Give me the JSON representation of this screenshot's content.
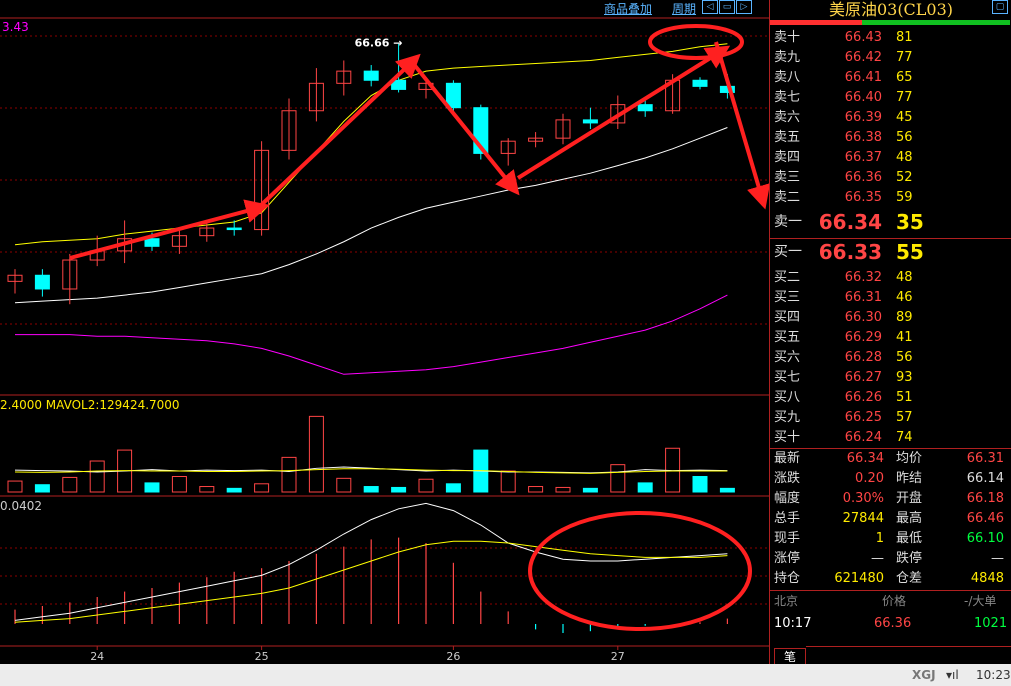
{
  "toolbar": {
    "overlay_label": "商品叠加",
    "period_label": "周期"
  },
  "indicator_labels": {
    "main_top": "3.43",
    "volume": "2.4000  MAVOL2:129424.7000",
    "macd": "0.0402"
  },
  "colors": {
    "up": "#ff4545",
    "down": "#00ffff",
    "ma1": "#ffff00",
    "ma2": "#ffffff",
    "ma3": "#ff00ff",
    "grid": "#8b0000",
    "arrow": "#ff2020"
  },
  "chart_data": [
    {
      "type": "candlestick",
      "name": "price",
      "x_ticks": [
        "24",
        "25",
        "26",
        "27"
      ],
      "peak_label": "66.66",
      "candles": [
        {
          "o": 65.1,
          "h": 65.18,
          "l": 65.02,
          "c": 65.14
        },
        {
          "o": 65.14,
          "h": 65.18,
          "l": 65.0,
          "c": 65.05
        },
        {
          "o": 65.05,
          "h": 65.28,
          "l": 64.95,
          "c": 65.24
        },
        {
          "o": 65.24,
          "h": 65.4,
          "l": 65.2,
          "c": 65.3
        },
        {
          "o": 65.3,
          "h": 65.5,
          "l": 65.22,
          "c": 65.38
        },
        {
          "o": 65.38,
          "h": 65.42,
          "l": 65.3,
          "c": 65.33
        },
        {
          "o": 65.33,
          "h": 65.45,
          "l": 65.28,
          "c": 65.4
        },
        {
          "o": 65.4,
          "h": 65.48,
          "l": 65.36,
          "c": 65.45
        },
        {
          "o": 65.45,
          "h": 65.5,
          "l": 65.4,
          "c": 65.44
        },
        {
          "o": 65.44,
          "h": 66.02,
          "l": 65.4,
          "c": 65.96
        },
        {
          "o": 65.96,
          "h": 66.3,
          "l": 65.9,
          "c": 66.22
        },
        {
          "o": 66.22,
          "h": 66.5,
          "l": 66.15,
          "c": 66.4
        },
        {
          "o": 66.4,
          "h": 66.55,
          "l": 66.32,
          "c": 66.48
        },
        {
          "o": 66.48,
          "h": 66.52,
          "l": 66.38,
          "c": 66.42
        },
        {
          "o": 66.42,
          "h": 66.66,
          "l": 66.34,
          "c": 66.36
        },
        {
          "o": 66.36,
          "h": 66.44,
          "l": 66.3,
          "c": 66.4
        },
        {
          "o": 66.4,
          "h": 66.42,
          "l": 66.2,
          "c": 66.24
        },
        {
          "o": 66.24,
          "h": 66.26,
          "l": 65.9,
          "c": 65.94
        },
        {
          "o": 65.94,
          "h": 66.04,
          "l": 65.86,
          "c": 66.02
        },
        {
          "o": 66.02,
          "h": 66.08,
          "l": 65.98,
          "c": 66.04
        },
        {
          "o": 66.04,
          "h": 66.2,
          "l": 66.0,
          "c": 66.16
        },
        {
          "o": 66.16,
          "h": 66.24,
          "l": 66.1,
          "c": 66.14
        },
        {
          "o": 66.14,
          "h": 66.32,
          "l": 66.1,
          "c": 66.26
        },
        {
          "o": 66.26,
          "h": 66.3,
          "l": 66.18,
          "c": 66.22
        },
        {
          "o": 66.22,
          "h": 66.46,
          "l": 66.2,
          "c": 66.42
        },
        {
          "o": 66.42,
          "h": 66.44,
          "l": 66.36,
          "c": 66.38
        },
        {
          "o": 66.38,
          "h": 66.46,
          "l": 66.3,
          "c": 66.34
        }
      ],
      "ma_yellow": [
        65.34,
        65.36,
        65.37,
        65.38,
        65.41,
        65.43,
        65.45,
        65.47,
        65.49,
        65.55,
        65.75,
        65.95,
        66.15,
        66.32,
        66.42,
        66.48,
        66.5,
        66.51,
        66.52,
        66.53,
        66.54,
        66.55,
        66.57,
        66.59,
        66.61,
        66.64,
        66.66
      ],
      "ma_white": [
        64.96,
        64.97,
        64.98,
        64.99,
        65.01,
        65.03,
        65.06,
        65.09,
        65.12,
        65.15,
        65.21,
        65.28,
        65.36,
        65.45,
        65.52,
        65.58,
        65.62,
        65.66,
        65.7,
        65.73,
        65.77,
        65.81,
        65.86,
        65.91,
        65.97,
        66.04,
        66.11
      ],
      "ma_magenta": [
        64.75,
        64.75,
        64.75,
        64.74,
        64.74,
        64.73,
        64.72,
        64.71,
        64.69,
        64.66,
        64.61,
        64.55,
        64.49,
        64.5,
        64.51,
        64.52,
        64.54,
        64.57,
        64.6,
        64.63,
        64.66,
        64.7,
        64.74,
        64.78,
        64.84,
        64.92,
        65.01
      ],
      "ylim": [
        64.4,
        66.75
      ]
    },
    {
      "type": "bar",
      "name": "volume",
      "values": [
        2,
        2,
        2,
        2,
        2,
        3,
        2,
        2,
        2,
        2,
        3,
        2,
        2,
        2,
        2,
        2,
        2,
        2,
        2,
        2,
        2,
        2,
        2,
        2,
        2,
        2,
        2
      ],
      "note_values": [
        12000,
        8000,
        16000,
        34000,
        46000,
        10000,
        17000,
        6000,
        4000,
        9000,
        38000,
        83000,
        15000,
        6000,
        5000,
        14000,
        9000,
        46000,
        23000,
        6000,
        5000,
        4000,
        30000,
        10000,
        48000,
        17000,
        4000
      ],
      "mavol1": [
        24000,
        23500,
        23000,
        22000,
        23000,
        24500,
        23000,
        24000,
        23500,
        24000,
        22500,
        26000,
        27500,
        26000,
        24500,
        23000,
        24000,
        23000,
        22000,
        22000,
        21500,
        21000,
        22000,
        24500,
        23500,
        24000,
        23500
      ],
      "mavol2": [
        22000,
        21500,
        22000,
        23000,
        23500,
        23000,
        23000,
        22500,
        22500,
        23000,
        23500,
        24500,
        25500,
        25500,
        25000,
        24000,
        23500,
        23500,
        22500,
        21500,
        21000,
        20500,
        21500,
        22500,
        23000,
        23000,
        23000
      ]
    },
    {
      "type": "line",
      "name": "macd",
      "dif": [
        0.02,
        0.04,
        0.06,
        0.09,
        0.12,
        0.15,
        0.18,
        0.21,
        0.24,
        0.27,
        0.33,
        0.41,
        0.5,
        0.58,
        0.64,
        0.67,
        0.63,
        0.55,
        0.45,
        0.4,
        0.36,
        0.35,
        0.35,
        0.36,
        0.37,
        0.38,
        0.39
      ],
      "dea": [
        0.01,
        0.02,
        0.03,
        0.05,
        0.07,
        0.09,
        0.11,
        0.13,
        0.15,
        0.17,
        0.2,
        0.25,
        0.3,
        0.35,
        0.4,
        0.44,
        0.46,
        0.46,
        0.45,
        0.43,
        0.41,
        0.39,
        0.38,
        0.37,
        0.37,
        0.37,
        0.38
      ],
      "hist": [
        0.08,
        0.1,
        0.12,
        0.15,
        0.18,
        0.2,
        0.23,
        0.26,
        0.29,
        0.31,
        0.35,
        0.39,
        0.43,
        0.47,
        0.48,
        0.45,
        0.34,
        0.18,
        0.07,
        -0.03,
        -0.05,
        -0.04,
        -0.03,
        -0.01,
        0.0,
        0.01,
        0.03
      ]
    }
  ],
  "quote": {
    "title": "美原油03(CL03)",
    "asks": [
      {
        "label": "卖十",
        "price": "66.43",
        "vol": "81"
      },
      {
        "label": "卖九",
        "price": "66.42",
        "vol": "77"
      },
      {
        "label": "卖八",
        "price": "66.41",
        "vol": "65"
      },
      {
        "label": "卖七",
        "price": "66.40",
        "vol": "77"
      },
      {
        "label": "卖六",
        "price": "66.39",
        "vol": "45"
      },
      {
        "label": "卖五",
        "price": "66.38",
        "vol": "56"
      },
      {
        "label": "卖四",
        "price": "66.37",
        "vol": "48"
      },
      {
        "label": "卖三",
        "price": "66.36",
        "vol": "52"
      },
      {
        "label": "卖二",
        "price": "66.35",
        "vol": "59"
      },
      {
        "label": "卖一",
        "price": "66.34",
        "vol": "35"
      }
    ],
    "bids": [
      {
        "label": "买一",
        "price": "66.33",
        "vol": "55"
      },
      {
        "label": "买二",
        "price": "66.32",
        "vol": "48"
      },
      {
        "label": "买三",
        "price": "66.31",
        "vol": "46"
      },
      {
        "label": "买四",
        "price": "66.30",
        "vol": "89"
      },
      {
        "label": "买五",
        "price": "66.29",
        "vol": "41"
      },
      {
        "label": "买六",
        "price": "66.28",
        "vol": "56"
      },
      {
        "label": "买七",
        "price": "66.27",
        "vol": "93"
      },
      {
        "label": "买八",
        "price": "66.26",
        "vol": "51"
      },
      {
        "label": "买九",
        "price": "66.25",
        "vol": "57"
      },
      {
        "label": "买十",
        "price": "66.24",
        "vol": "74"
      }
    ],
    "stats": [
      {
        "l1": "最新",
        "v1": "66.34",
        "c1": "#ff4545",
        "l2": "均价",
        "v2": "66.31",
        "c2": "#ff4545"
      },
      {
        "l1": "涨跌",
        "v1": "0.20",
        "c1": "#ff4545",
        "l2": "昨结",
        "v2": "66.14",
        "c2": "#dddddd"
      },
      {
        "l1": "幅度",
        "v1": "0.30%",
        "c1": "#ff4545",
        "l2": "开盘",
        "v2": "66.18",
        "c2": "#ff4545"
      },
      {
        "l1": "总手",
        "v1": "27844",
        "c1": "#ffea00",
        "l2": "最高",
        "v2": "66.46",
        "c2": "#ff4545"
      },
      {
        "l1": "现手",
        "v1": "1",
        "c1": "#ffea00",
        "l2": "最低",
        "v2": "66.10",
        "c2": "#00ff40"
      },
      {
        "l1": "涨停",
        "v1": "—",
        "c1": "#dddddd",
        "l2": "跌停",
        "v2": "—",
        "c2": "#dddddd"
      },
      {
        "l1": "持仓",
        "v1": "621480",
        "c1": "#ffea00",
        "l2": "仓差",
        "v2": "4848",
        "c2": "#ffea00"
      }
    ],
    "tick_header": {
      "time": "北京",
      "price": "价格",
      "vol": "-/大单"
    },
    "tick": {
      "time": "10:17",
      "price": "66.36",
      "vol": "1021"
    },
    "tab_label": "笔"
  },
  "status": {
    "brand": "XGJ",
    "time": "10:23"
  }
}
